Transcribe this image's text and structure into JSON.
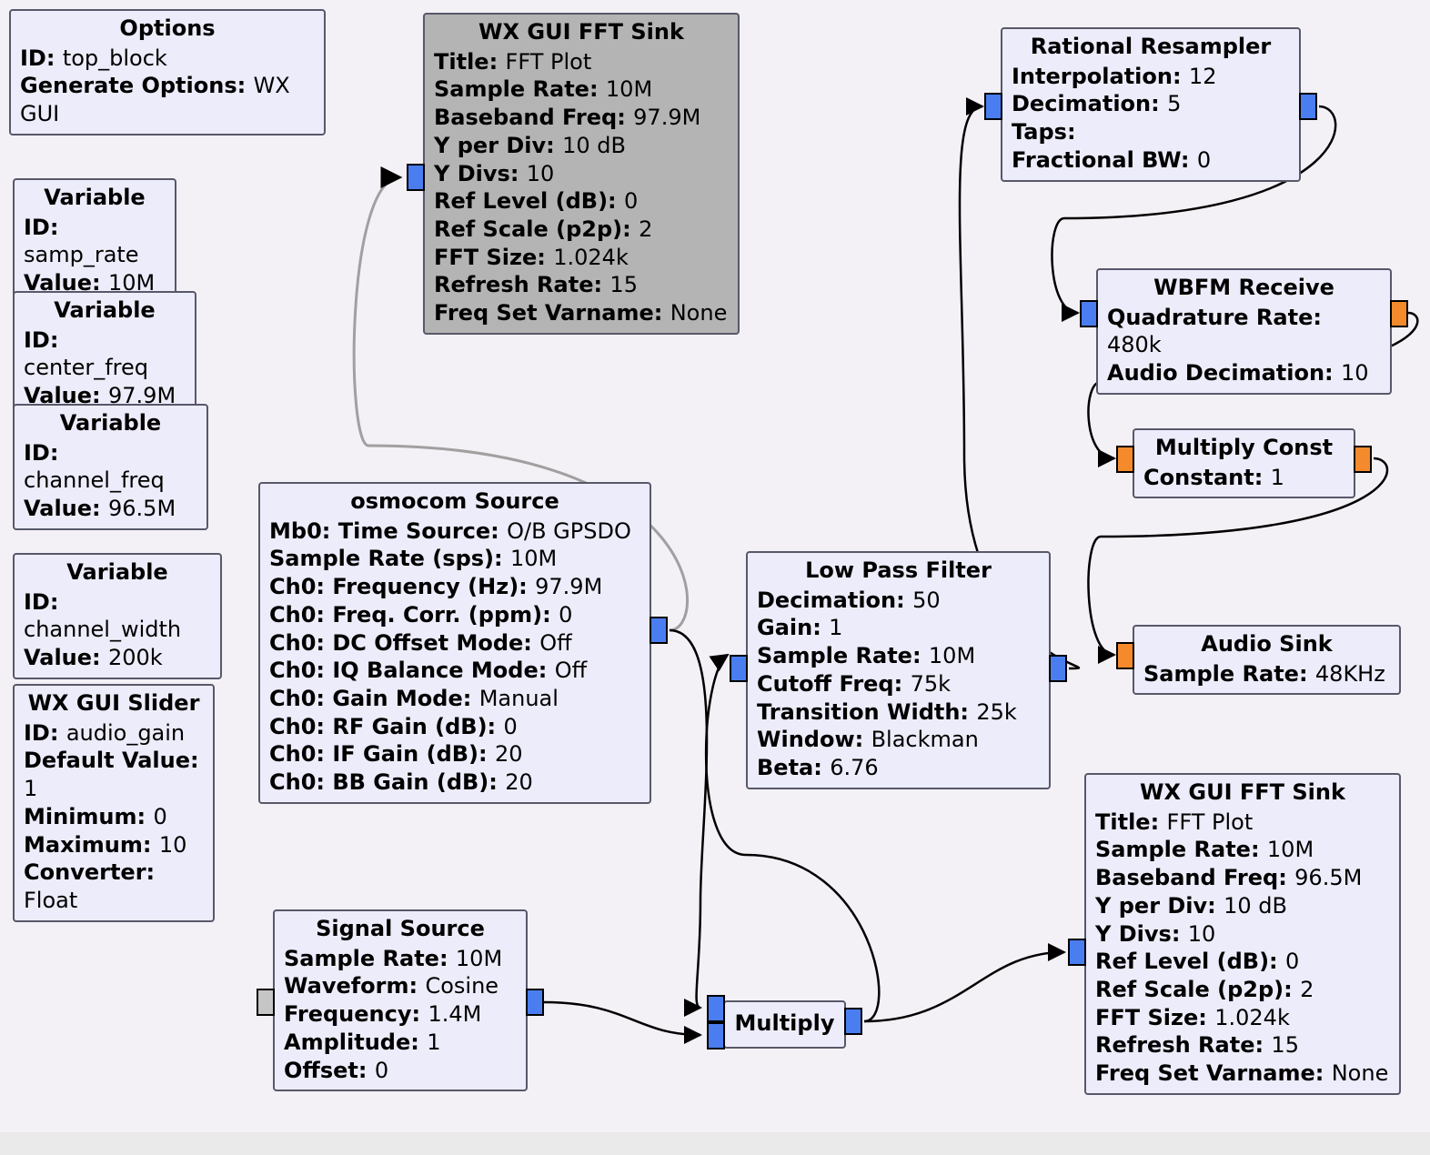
{
  "blocks": {
    "options": {
      "title": "Options",
      "rows": [
        {
          "k": "ID:",
          "v": "top_block"
        },
        {
          "k": "Generate Options:",
          "v": "WX GUI"
        }
      ]
    },
    "var_samp_rate": {
      "title": "Variable",
      "rows": [
        {
          "k": "ID:",
          "v": "samp_rate"
        },
        {
          "k": "Value:",
          "v": "10M"
        }
      ]
    },
    "var_center_freq": {
      "title": "Variable",
      "rows": [
        {
          "k": "ID:",
          "v": "center_freq"
        },
        {
          "k": "Value:",
          "v": "97.9M"
        }
      ]
    },
    "var_channel_freq": {
      "title": "Variable",
      "rows": [
        {
          "k": "ID:",
          "v": "channel_freq"
        },
        {
          "k": "Value:",
          "v": "96.5M"
        }
      ]
    },
    "var_channel_width": {
      "title": "Variable",
      "rows": [
        {
          "k": "ID:",
          "v": "channel_width"
        },
        {
          "k": "Value:",
          "v": "200k"
        }
      ]
    },
    "slider": {
      "title": "WX GUI Slider",
      "rows": [
        {
          "k": "ID:",
          "v": "audio_gain"
        },
        {
          "k": "Default Value:",
          "v": "1"
        },
        {
          "k": "Minimum:",
          "v": "0"
        },
        {
          "k": "Maximum:",
          "v": "10"
        },
        {
          "k": "Converter:",
          "v": "Float"
        }
      ]
    },
    "fft1": {
      "title": "WX GUI FFT Sink",
      "rows": [
        {
          "k": "Title:",
          "v": "FFT Plot"
        },
        {
          "k": "Sample Rate:",
          "v": "10M"
        },
        {
          "k": "Baseband Freq:",
          "v": "97.9M"
        },
        {
          "k": "Y per Div:",
          "v": "10 dB"
        },
        {
          "k": "Y Divs:",
          "v": "10"
        },
        {
          "k": "Ref Level (dB):",
          "v": "0"
        },
        {
          "k": "Ref Scale (p2p):",
          "v": "2"
        },
        {
          "k": "FFT Size:",
          "v": "1.024k"
        },
        {
          "k": "Refresh Rate:",
          "v": "15"
        },
        {
          "k": "Freq Set Varname:",
          "v": "None"
        }
      ]
    },
    "osmo": {
      "title": "osmocom Source",
      "rows": [
        {
          "k": "Mb0: Time Source:",
          "v": "O/B GPSDO"
        },
        {
          "k": "Sample Rate (sps):",
          "v": "10M"
        },
        {
          "k": "Ch0: Frequency (Hz):",
          "v": "97.9M"
        },
        {
          "k": "Ch0: Freq. Corr. (ppm):",
          "v": "0"
        },
        {
          "k": "Ch0: DC Offset Mode:",
          "v": "Off"
        },
        {
          "k": "Ch0: IQ Balance Mode:",
          "v": "Off"
        },
        {
          "k": "Ch0: Gain Mode:",
          "v": "Manual"
        },
        {
          "k": "Ch0: RF Gain (dB):",
          "v": "0"
        },
        {
          "k": "Ch0: IF Gain (dB):",
          "v": "20"
        },
        {
          "k": "Ch0: BB Gain (dB):",
          "v": "20"
        }
      ]
    },
    "sigsrc": {
      "title": "Signal Source",
      "rows": [
        {
          "k": "Sample Rate:",
          "v": "10M"
        },
        {
          "k": "Waveform:",
          "v": "Cosine"
        },
        {
          "k": "Frequency:",
          "v": "1.4M"
        },
        {
          "k": "Amplitude:",
          "v": "1"
        },
        {
          "k": "Offset:",
          "v": "0"
        }
      ]
    },
    "lpf": {
      "title": "Low Pass Filter",
      "rows": [
        {
          "k": "Decimation:",
          "v": "50"
        },
        {
          "k": "Gain:",
          "v": "1"
        },
        {
          "k": "Sample Rate:",
          "v": "10M"
        },
        {
          "k": "Cutoff Freq:",
          "v": "75k"
        },
        {
          "k": "Transition Width:",
          "v": "25k"
        },
        {
          "k": "Window:",
          "v": "Blackman"
        },
        {
          "k": "Beta:",
          "v": "6.76"
        }
      ]
    },
    "mult": {
      "title": "Multiply",
      "rows": []
    },
    "resamp": {
      "title": "Rational Resampler",
      "rows": [
        {
          "k": "Interpolation:",
          "v": "12"
        },
        {
          "k": "Decimation:",
          "v": "5"
        },
        {
          "k": "Taps:",
          "v": ""
        },
        {
          "k": "Fractional BW:",
          "v": "0"
        }
      ]
    },
    "wbfm": {
      "title": "WBFM Receive",
      "rows": [
        {
          "k": "Quadrature Rate:",
          "v": "480k"
        },
        {
          "k": "Audio Decimation:",
          "v": "10"
        }
      ]
    },
    "mconst": {
      "title": "Multiply Const",
      "rows": [
        {
          "k": "Constant:",
          "v": "1"
        }
      ]
    },
    "audio": {
      "title": "Audio Sink",
      "rows": [
        {
          "k": "Sample Rate:",
          "v": "48KHz"
        }
      ]
    },
    "fft2": {
      "title": "WX GUI FFT Sink",
      "rows": [
        {
          "k": "Title:",
          "v": "FFT Plot"
        },
        {
          "k": "Sample Rate:",
          "v": "10M"
        },
        {
          "k": "Baseband Freq:",
          "v": "96.5M"
        },
        {
          "k": "Y per Div:",
          "v": "10 dB"
        },
        {
          "k": "Y Divs:",
          "v": "10"
        },
        {
          "k": "Ref Level (dB):",
          "v": "0"
        },
        {
          "k": "Ref Scale (p2p):",
          "v": "2"
        },
        {
          "k": "FFT Size:",
          "v": "1.024k"
        },
        {
          "k": "Refresh Rate:",
          "v": "15"
        },
        {
          "k": "Freq Set Varname:",
          "v": "None"
        }
      ]
    }
  }
}
